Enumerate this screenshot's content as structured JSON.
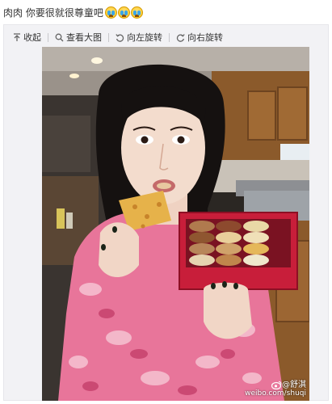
{
  "post": {
    "text": "肉肉 你要很就很尊童吧",
    "emojis": [
      "crying-face-icon",
      "crying-face-icon",
      "crying-face-icon"
    ]
  },
  "toolbar": {
    "collapse_label": "收起",
    "view_large_label": "查看大图",
    "rotate_left_label": "向左旋转",
    "rotate_right_label": "向右旋转"
  },
  "photo": {
    "watermark_handle": "@舒淇",
    "watermark_url": "weibo.com/shuqi"
  },
  "colors": {
    "background": "#ffffff",
    "card_background": "#f2f2f5",
    "toolbar_icon": "#666666",
    "macaron_box": "#c81e3a",
    "jacket_pink": "#e8759a"
  }
}
